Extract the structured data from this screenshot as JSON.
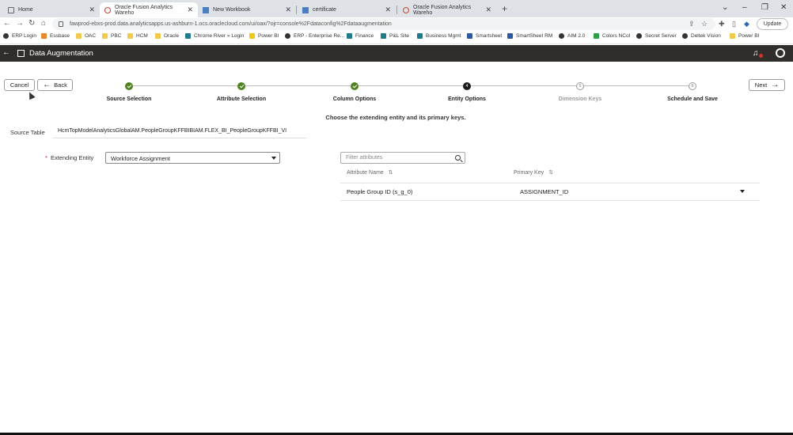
{
  "browser": {
    "tabs": [
      {
        "label": "Home",
        "active": false
      },
      {
        "label": "Oracle Fusion Analytics Wareho",
        "active": true
      },
      {
        "label": "New Workbook",
        "active": false
      },
      {
        "label": "certificate",
        "active": false
      },
      {
        "label": "Oracle Fusion Analytics Wareho",
        "active": false
      }
    ],
    "url": "fawprod-ebxs-prod.data.analyticsapps.us-ashburn-1.ocs.oraclecloud.com/ui/oax/?ojr=console%2Fdataconfig%2Fdataaugmentation",
    "update_label": "Update",
    "bookmarks": [
      "ERP Login",
      "Essbase",
      "OAC",
      "PBC",
      "HCM",
      "Oracle",
      "Chrome River » Login",
      "Power BI",
      "ERP - Enterprise Re...",
      "Finance",
      "P&L Site",
      "Business Mgmt",
      "Smartsheet",
      "SmartSheet RM",
      "AIM 2.0",
      "Colors NCol",
      "Secret Server",
      "Deltek Vision",
      "Power BI"
    ]
  },
  "app": {
    "title": "Data Augmentation"
  },
  "wizard": {
    "cancel_label": "Cancel",
    "back_label": "Back",
    "next_label": "Next",
    "steps": [
      {
        "label": "Source Selection",
        "state": "done",
        "num": ""
      },
      {
        "label": "Attribute Selection",
        "state": "done",
        "num": ""
      },
      {
        "label": "Column Options",
        "state": "done",
        "num": ""
      },
      {
        "label": "Entity Options",
        "state": "current",
        "num": "4"
      },
      {
        "label": "Dimension Keys",
        "state": "future",
        "num": "5"
      },
      {
        "label": "Schedule and Save",
        "state": "future",
        "num": "6"
      }
    ],
    "instruction": "Choose the extending entity and its primary keys."
  },
  "form": {
    "source_table_label": "Source Table",
    "source_table_value": "HcmTopModelAnalyticsGlobalAM.PeopleGroupKFFBIBIAM.FLEX_BI_PeopleGroupKFFBI_VI",
    "required_marker": "*",
    "extending_entity_label": "Extending Entity",
    "extending_entity_value": "Workforce Assignment"
  },
  "attributes": {
    "filter_placeholder": "Filter attributes",
    "columns": [
      "Attribute Name",
      "Primary Key"
    ],
    "rows": [
      {
        "attribute": "People Group ID (s_g_0)",
        "primary_key": "ASSIGNMENT_ID"
      }
    ]
  }
}
